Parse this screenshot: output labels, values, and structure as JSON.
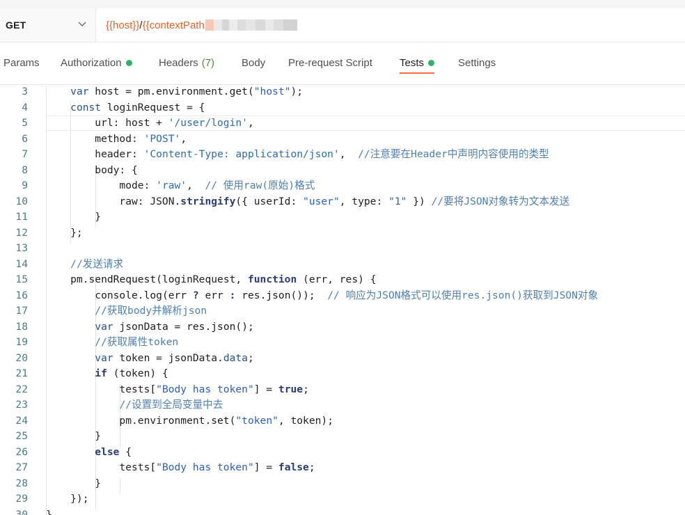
{
  "request": {
    "method": "GET",
    "url_var_host": "{{host}}",
    "url_slash": "/",
    "url_var_context": "{{contextPath"
  },
  "tabs": [
    {
      "label": "Params"
    },
    {
      "label": "Authorization"
    },
    {
      "label": "Headers",
      "count": "(7)"
    },
    {
      "label": "Body"
    },
    {
      "label": "Pre-request Script"
    },
    {
      "label": "Tests"
    },
    {
      "label": "Settings"
    }
  ],
  "active_tab": "Tests",
  "colors": {
    "accent": "#ff6c37",
    "status_dot": "#2cb561",
    "url_var": "#e8622a"
  },
  "editor": {
    "lines": [
      {
        "n": "3",
        "tokens": [
          [
            "    ",
            ""
          ],
          [
            "var",
            "kw"
          ],
          [
            " host = pm.environment.",
            ""
          ],
          [
            "get",
            "fn"
          ],
          [
            "(",
            ""
          ],
          [
            "\"host\"",
            "str"
          ],
          [
            ");",
            ""
          ]
        ]
      },
      {
        "n": "4",
        "tokens": [
          [
            "    ",
            ""
          ],
          [
            "const",
            "kw"
          ],
          [
            " loginRequest = {",
            ""
          ]
        ]
      },
      {
        "n": "5",
        "tokens": [
          [
            "        url: host + ",
            ""
          ],
          [
            "'/user/login'",
            "sq"
          ],
          [
            ",",
            ""
          ]
        ]
      },
      {
        "n": "6",
        "tokens": [
          [
            "        method: ",
            ""
          ],
          [
            "'POST'",
            "sq"
          ],
          [
            ",",
            ""
          ]
        ]
      },
      {
        "n": "7",
        "tokens": [
          [
            "        header: ",
            ""
          ],
          [
            "'Content-Type: application/json'",
            "sq"
          ],
          [
            ",  ",
            ""
          ],
          [
            "//注意要在Header中声明内容使用的类型",
            "cm"
          ]
        ]
      },
      {
        "n": "8",
        "tokens": [
          [
            "        body: {",
            ""
          ]
        ]
      },
      {
        "n": "9",
        "tokens": [
          [
            "            mode: ",
            ""
          ],
          [
            "'raw'",
            "sq"
          ],
          [
            ",  ",
            ""
          ],
          [
            "// 使用raw(原始)格式",
            "cm"
          ]
        ]
      },
      {
        "n": "10",
        "tokens": [
          [
            "            raw: JSON.",
            ""
          ],
          [
            "stringify",
            "kb"
          ],
          [
            "({ userId: ",
            ""
          ],
          [
            "\"user\"",
            "str"
          ],
          [
            ", type: ",
            ""
          ],
          [
            "\"1\"",
            "str"
          ],
          [
            " }) ",
            ""
          ],
          [
            "//要将JSON对象转为文本发送",
            "cm"
          ]
        ]
      },
      {
        "n": "11",
        "tokens": [
          [
            "        }",
            ""
          ]
        ]
      },
      {
        "n": "12",
        "tokens": [
          [
            "    };",
            ""
          ]
        ]
      },
      {
        "n": "13",
        "tokens": [
          [
            "",
            ""
          ]
        ]
      },
      {
        "n": "14",
        "tokens": [
          [
            "    ",
            ""
          ],
          [
            "//发送请求",
            "cm"
          ]
        ]
      },
      {
        "n": "15",
        "tokens": [
          [
            "    pm.",
            ""
          ],
          [
            "sendRequest",
            "fn"
          ],
          [
            "(loginRequest, ",
            ""
          ],
          [
            "function",
            "kb"
          ],
          [
            " (err, res) {",
            ""
          ]
        ]
      },
      {
        "n": "16",
        "tokens": [
          [
            "        console.",
            ""
          ],
          [
            "log",
            "fn"
          ],
          [
            "(err ",
            ""
          ],
          [
            "?",
            "kb"
          ],
          [
            " err ",
            ""
          ],
          [
            ":",
            "kb"
          ],
          [
            " res.",
            ""
          ],
          [
            "json",
            "fn"
          ],
          [
            "());  ",
            ""
          ],
          [
            "// 响应为JSON格式可以使用res.json()获取到JSON对象",
            "cm"
          ]
        ]
      },
      {
        "n": "17",
        "tokens": [
          [
            "        ",
            ""
          ],
          [
            "//获取body并解析json",
            "cm"
          ]
        ]
      },
      {
        "n": "18",
        "tokens": [
          [
            "        ",
            ""
          ],
          [
            "var",
            "kw"
          ],
          [
            " jsonData = res.",
            ""
          ],
          [
            "json",
            "fn"
          ],
          [
            "();",
            ""
          ]
        ]
      },
      {
        "n": "19",
        "tokens": [
          [
            "        ",
            ""
          ],
          [
            "//获取属性token",
            "cm"
          ]
        ]
      },
      {
        "n": "20",
        "tokens": [
          [
            "        ",
            ""
          ],
          [
            "var",
            "kw"
          ],
          [
            " token = jsonData.",
            ""
          ],
          [
            "data",
            "kw"
          ],
          [
            ";",
            ""
          ]
        ]
      },
      {
        "n": "21",
        "tokens": [
          [
            "        ",
            ""
          ],
          [
            "if",
            "kb"
          ],
          [
            " (token) {",
            ""
          ]
        ]
      },
      {
        "n": "22",
        "tokens": [
          [
            "            tests[",
            ""
          ],
          [
            "\"Body has token\"",
            "str"
          ],
          [
            "] = ",
            ""
          ],
          [
            "true",
            "kb"
          ],
          [
            ";",
            ""
          ]
        ]
      },
      {
        "n": "23",
        "tokens": [
          [
            "            ",
            ""
          ],
          [
            "//设置到全局变量中去",
            "cm"
          ]
        ]
      },
      {
        "n": "24",
        "tokens": [
          [
            "            pm.environment.",
            ""
          ],
          [
            "set",
            "fn"
          ],
          [
            "(",
            ""
          ],
          [
            "\"token\"",
            "str"
          ],
          [
            ", token);",
            ""
          ]
        ]
      },
      {
        "n": "25",
        "tokens": [
          [
            "        }",
            ""
          ]
        ]
      },
      {
        "n": "26",
        "tokens": [
          [
            "        ",
            ""
          ],
          [
            "else",
            "kb"
          ],
          [
            " {",
            ""
          ]
        ]
      },
      {
        "n": "27",
        "tokens": [
          [
            "            tests[",
            ""
          ],
          [
            "\"Body has token\"",
            "str"
          ],
          [
            "] = ",
            ""
          ],
          [
            "false",
            "kb"
          ],
          [
            ";",
            ""
          ]
        ]
      },
      {
        "n": "28",
        "tokens": [
          [
            "        }",
            ""
          ]
        ]
      },
      {
        "n": "29",
        "tokens": [
          [
            "    });",
            ""
          ]
        ]
      },
      {
        "n": "30",
        "tokens": [
          [
            "}",
            ""
          ]
        ]
      }
    ]
  }
}
